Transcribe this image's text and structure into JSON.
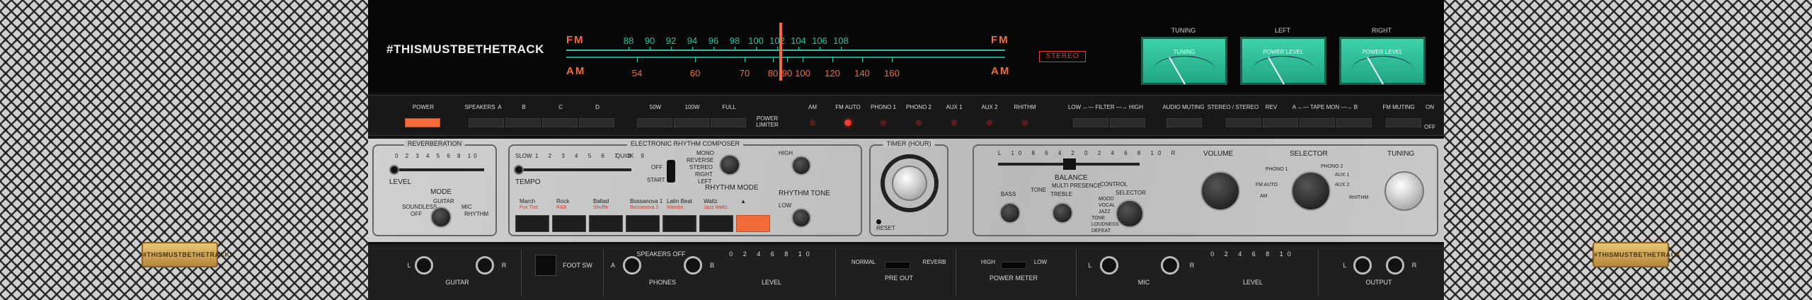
{
  "brand": "#THISMUSTBETHETRACK",
  "badge": "#THISMUSTBETHETRACK",
  "tuner": {
    "fm_label": "FM",
    "am_label": "AM",
    "fm_scale": [
      "88",
      "90",
      "92",
      "94",
      "96",
      "98",
      "100",
      "102",
      "104",
      "106",
      "108"
    ],
    "am_scale": [
      "54",
      "60",
      "70",
      "80",
      "90",
      "100",
      "120",
      "140",
      "160"
    ],
    "stereo": "STEREO"
  },
  "meters": [
    {
      "title": "TUNING",
      "face": "TUNING"
    },
    {
      "title": "LEFT",
      "face": "POWER LEVEL"
    },
    {
      "title": "RIGHT",
      "face": "POWER LEVEL"
    }
  ],
  "switches": {
    "power": "POWER",
    "speakers": "SPEAKERS",
    "spk_a": "A",
    "spk_b": "B",
    "spk_c": "C",
    "spk_d": "D",
    "w50": "50W",
    "w100": "100W",
    "full": "FULL",
    "power_limiter": "POWER LIMITER",
    "sources": [
      "AM",
      "FM AUTO",
      "PHONO 1",
      "PHONO 2",
      "AUX 1",
      "AUX 2",
      "RHITHM"
    ],
    "filter": "LOW ←— FILTER —→ HIGH",
    "audio_muting": "AUDIO MUTING",
    "stereo_mono": "STEREO / STEREO",
    "rev": "REV",
    "tape_mon": "A ←— TAPE MON —→ B",
    "fm_muting": "FM MUTING",
    "on": "ON",
    "off": "OFF"
  },
  "reverb": {
    "title": "REVERBERATION",
    "scale": "0 2 3 4 5 6 8 10",
    "level": "LEVEL",
    "mode": "MODE",
    "guitar": "GUITAR",
    "soundless": "SOUNDLESS",
    "off": "OFF",
    "mic": "MIC",
    "rhythm": "RHYTHM"
  },
  "rhythm": {
    "title": "ELECTRONIC RHYTHM COMPOSER",
    "slow": "SLOW",
    "quick": "QUICK",
    "scale": "1 2 3 4 5 6 7 8 9",
    "tempo": "TEMPO",
    "off": "OFF",
    "start": "START",
    "mono": "MONO",
    "reverse": "REVERSE",
    "stereo": "STEREO",
    "right": "RIGHT",
    "left": "LEFT",
    "rhythm_mode": "RHYTHM MODE",
    "high": "HIGH",
    "low": "LOW",
    "rhythm_tone": "RHYTHM TONE",
    "patterns": [
      {
        "top": "March",
        "bottom": "Fox Trot"
      },
      {
        "top": "Rock",
        "bottom": "R&B"
      },
      {
        "top": "Ballad",
        "bottom": "Shuffle"
      },
      {
        "top": "Bossanova 1",
        "bottom": "Bossanova 2"
      },
      {
        "top": "Latin Beat",
        "bottom": "Mambo"
      },
      {
        "top": "Waltz",
        "bottom": "Jazz Waltz"
      },
      {
        "top": "▲",
        "bottom": ""
      }
    ]
  },
  "timer": {
    "title": "TIMER (HOUR)",
    "reset": "RESET"
  },
  "tone": {
    "scale": "L 10 8 6 4 2 0 2 4 6 8 10 R",
    "balance": "BALANCE",
    "bass": "BASS",
    "tone": "TONE",
    "treble": "TREBLE",
    "multi": "MULTI PRESENCE",
    "control": "CONTROL",
    "selector": "SELECTOR",
    "modes": [
      "MOOD",
      "VOCAL",
      "JAZZ",
      "TONE",
      "LOUDNESS",
      "DEFEAT"
    ],
    "volume": "VOLUME",
    "selector_big": "SELECTOR",
    "tuning": "TUNING",
    "sel_options": [
      "PHONO 1",
      "PHONO 2",
      "AUX 1",
      "AUX 2",
      "FM AUTO",
      "AM",
      "RHITHM"
    ]
  },
  "bottom": {
    "guitar": "GUITAR",
    "foot_sw": "FOOT SW",
    "speakers_off": "SPEAKERS OFF",
    "phones": "PHONES",
    "level": "LEVEL",
    "level_scale": "0 2 4 6 8 10",
    "normal": "NORMAL",
    "reverb": "REVERB",
    "pre_out": "PRE OUT",
    "high": "HIGH",
    "low": "LOW",
    "power_meter": "POWER METER",
    "mic": "MIC",
    "mic_level": "LEVEL",
    "output": "OUTPUT",
    "l": "L",
    "r": "R",
    "a": "A",
    "b": "B"
  }
}
